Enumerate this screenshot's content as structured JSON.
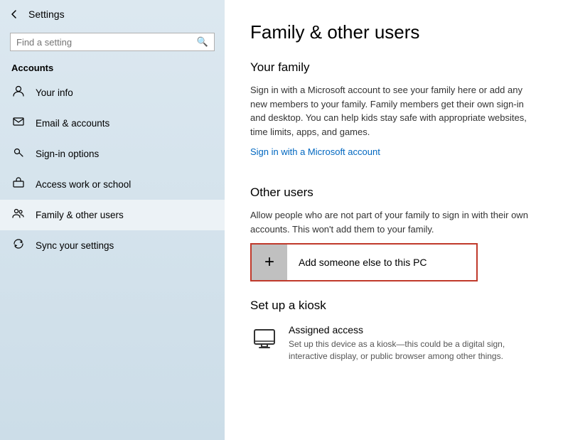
{
  "sidebar": {
    "title": "Settings",
    "search": {
      "placeholder": "Find a setting"
    },
    "accounts_label": "Accounts",
    "items": [
      {
        "id": "your-info",
        "label": "Your info",
        "icon": "person"
      },
      {
        "id": "email-accounts",
        "label": "Email & accounts",
        "icon": "email"
      },
      {
        "id": "sign-in-options",
        "label": "Sign-in options",
        "icon": "key"
      },
      {
        "id": "access-work-school",
        "label": "Access work or school",
        "icon": "briefcase"
      },
      {
        "id": "family-other-users",
        "label": "Family & other users",
        "icon": "family",
        "active": true
      },
      {
        "id": "sync-settings",
        "label": "Sync your settings",
        "icon": "sync"
      }
    ]
  },
  "main": {
    "page_title": "Family & other users",
    "your_family": {
      "heading": "Your family",
      "description": "Sign in with a Microsoft account to see your family here or add any new members to your family. Family members get their own sign-in and desktop. You can help kids stay safe with appropriate websites, time limits, apps, and games.",
      "link": "Sign in with a Microsoft account"
    },
    "other_users": {
      "heading": "Other users",
      "description": "Allow people who are not part of your family to sign in with their own accounts. This won't add them to your family.",
      "add_button": "Add someone else to this PC"
    },
    "kiosk": {
      "heading": "Set up a kiosk",
      "assigned_access": {
        "title": "Assigned access",
        "description": "Set up this device as a kiosk—this could be a digital sign, interactive display, or public browser among other things."
      }
    }
  }
}
